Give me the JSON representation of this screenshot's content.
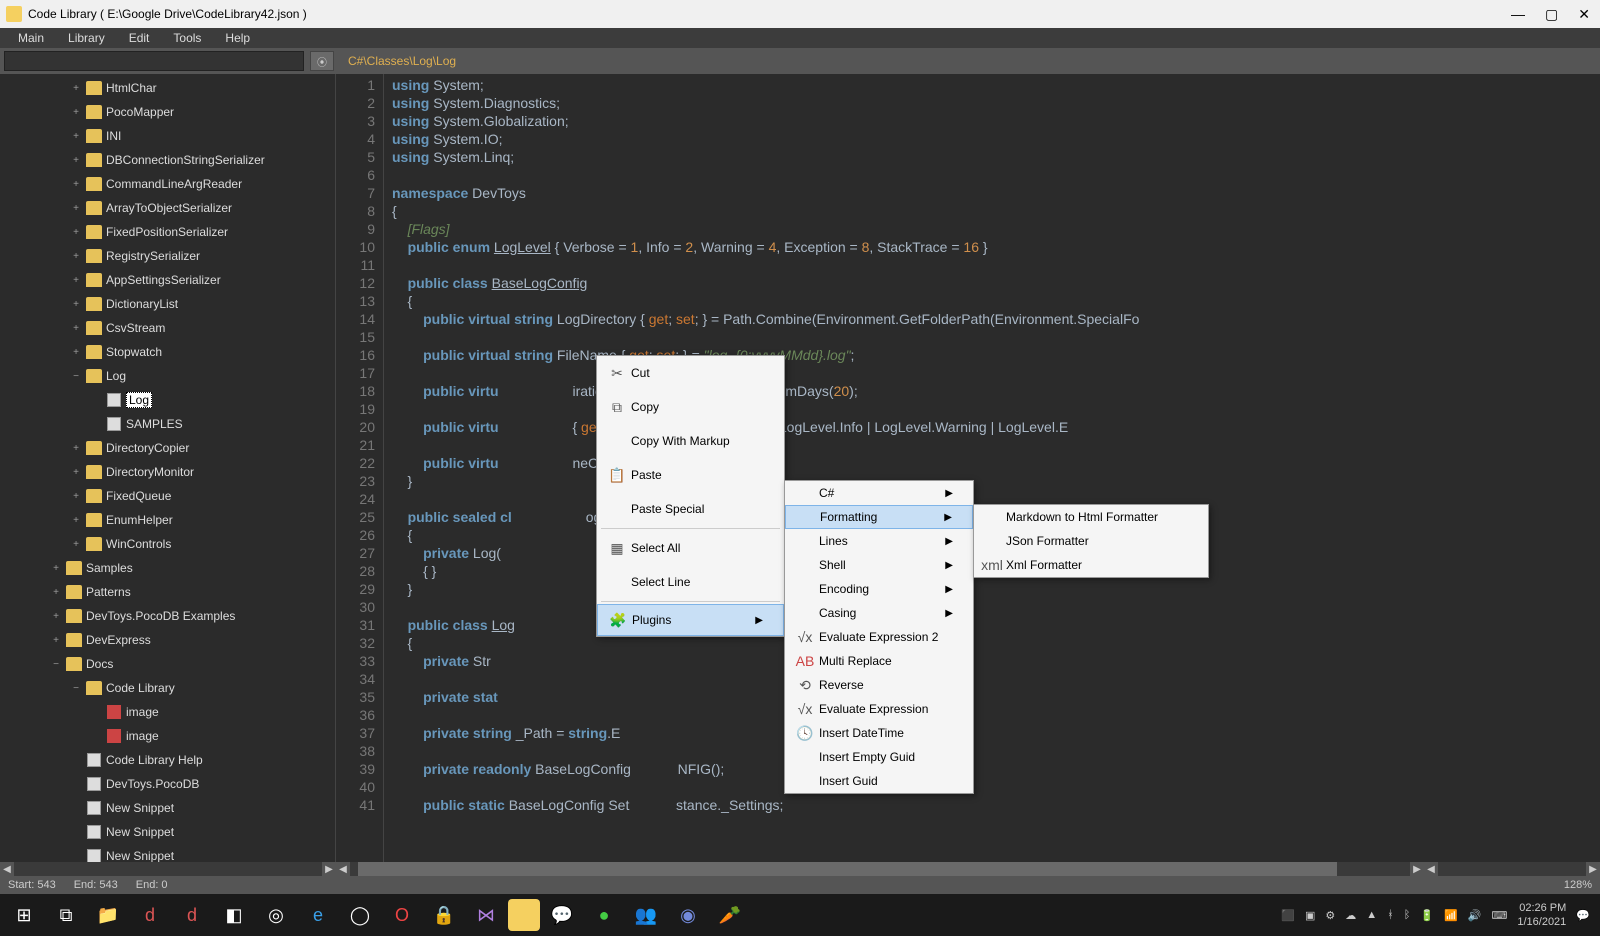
{
  "window": {
    "title": "Code Library ( E:\\Google Drive\\CodeLibrary42.json )"
  },
  "menu": [
    "Main",
    "Library",
    "Edit",
    "Tools",
    "Help"
  ],
  "breadcrumb": "C#\\Classes\\Log\\Log",
  "tree": [
    {
      "l": 3,
      "t": "folder",
      "tog": "+",
      "label": "HtmlChar"
    },
    {
      "l": 3,
      "t": "folder",
      "tog": "+",
      "label": "PocoMapper"
    },
    {
      "l": 3,
      "t": "folder",
      "tog": "+",
      "label": "INI"
    },
    {
      "l": 3,
      "t": "folder",
      "tog": "+",
      "label": "DBConnectionStringSerializer"
    },
    {
      "l": 3,
      "t": "folder",
      "tog": "+",
      "label": "CommandLineArgReader"
    },
    {
      "l": 3,
      "t": "folder",
      "tog": "+",
      "label": "ArrayToObjectSerializer"
    },
    {
      "l": 3,
      "t": "folder",
      "tog": "+",
      "label": "FixedPositionSerializer"
    },
    {
      "l": 3,
      "t": "folder",
      "tog": "+",
      "label": "RegistrySerializer"
    },
    {
      "l": 3,
      "t": "folder",
      "tog": "+",
      "label": "AppSettingsSerializer"
    },
    {
      "l": 3,
      "t": "folder",
      "tog": "+",
      "label": "DictionaryList"
    },
    {
      "l": 3,
      "t": "folder",
      "tog": "+",
      "label": "CsvStream"
    },
    {
      "l": 3,
      "t": "folder",
      "tog": "+",
      "label": "Stopwatch"
    },
    {
      "l": 3,
      "t": "folder",
      "tog": "−",
      "label": "Log"
    },
    {
      "l": 4,
      "t": "file",
      "label": "Log",
      "sel": true
    },
    {
      "l": 4,
      "t": "file",
      "label": "SAMPLES"
    },
    {
      "l": 3,
      "t": "folder",
      "tog": "+",
      "label": "DirectoryCopier"
    },
    {
      "l": 3,
      "t": "folder",
      "tog": "+",
      "label": "DirectoryMonitor"
    },
    {
      "l": 3,
      "t": "folder",
      "tog": "+",
      "label": "FixedQueue"
    },
    {
      "l": 3,
      "t": "folder",
      "tog": "+",
      "label": "EnumHelper"
    },
    {
      "l": 3,
      "t": "folder",
      "tog": "+",
      "label": "WinControls"
    },
    {
      "l": 2,
      "t": "folder",
      "tog": "+",
      "label": "Samples"
    },
    {
      "l": 2,
      "t": "folder",
      "tog": "+",
      "label": "Patterns"
    },
    {
      "l": 2,
      "t": "folder",
      "tog": "+",
      "label": "DevToys.PocoDB Examples"
    },
    {
      "l": 2,
      "t": "folder",
      "tog": "+",
      "label": "DevExpress"
    },
    {
      "l": 2,
      "t": "folder",
      "tog": "−",
      "label": "Docs"
    },
    {
      "l": 3,
      "t": "folder",
      "tog": "−",
      "label": "Code Library"
    },
    {
      "l": 4,
      "t": "red",
      "label": "image"
    },
    {
      "l": 4,
      "t": "red",
      "label": "image"
    },
    {
      "l": 3,
      "t": "file",
      "label": "Code Library Help"
    },
    {
      "l": 3,
      "t": "file",
      "label": "DevToys.PocoDB"
    },
    {
      "l": 3,
      "t": "file",
      "label": "New Snippet"
    },
    {
      "l": 3,
      "t": "file",
      "label": "New Snippet"
    },
    {
      "l": 3,
      "t": "file",
      "label": "New Snippet"
    }
  ],
  "lines": [
    "1",
    "2",
    "3",
    "4",
    "5",
    "6",
    "7",
    "8",
    "9",
    "10",
    "11",
    "12",
    "13",
    "14",
    "15",
    "16",
    "17",
    "18",
    "19",
    "20",
    "21",
    "22",
    "23",
    "24",
    "25",
    "26",
    "27",
    "28",
    "29",
    "30",
    "31",
    "32",
    "33",
    "34",
    "35",
    "36",
    "37",
    "38",
    "39",
    "40",
    "41"
  ],
  "context1": {
    "cut": "Cut",
    "copy": "Copy",
    "copymarkup": "Copy With Markup",
    "paste": "Paste",
    "pastesp": "Paste Special",
    "selall": "Select All",
    "selline": "Select Line",
    "plugins": "Plugins"
  },
  "context2": {
    "csharp": "C#",
    "formatting": "Formatting",
    "lines": "Lines",
    "shell": "Shell",
    "encoding": "Encoding",
    "casing": "Casing",
    "eval2": "Evaluate Expression 2",
    "multi": "Multi Replace",
    "reverse": "Reverse",
    "eval": "Evaluate Expression",
    "insdt": "Insert DateTime",
    "inseg": "Insert Empty Guid",
    "insg": "Insert Guid"
  },
  "context3": {
    "md": "Markdown to Html Formatter",
    "json": "JSon Formatter",
    "xml": "Xml Formatter"
  },
  "status": {
    "start": "Start:  543",
    "end1": "End:  543",
    "end2": "End:  0",
    "zoom": "128%"
  },
  "tray": {
    "time": "02:26 PM",
    "date": "1/16/2021"
  }
}
